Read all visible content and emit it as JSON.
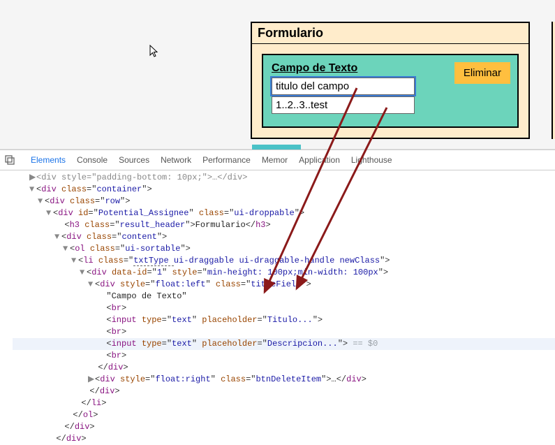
{
  "form": {
    "header": "Formulario",
    "field_label": "Campo de Texto",
    "delete_label": "Eliminar",
    "title_value": "titulo del campo",
    "title_placeholder": "Titulo...",
    "desc_value": "1..2..3..test",
    "desc_placeholder": "Descripcion..."
  },
  "devtools": {
    "tabs": [
      "Elements",
      "Console",
      "Sources",
      "Network",
      "Performance",
      "Memor",
      "Application",
      "Lighthouse"
    ],
    "partial_top": "<div style=\"padding-bottom: 10px;\">…</div>",
    "l_container_open": "<div class=\"container\">",
    "l_row_open": "<div class=\"row\">",
    "l_potential_open": "<div id=\"Potential_Assignee\" class=\"ui-droppable\">",
    "l_h3": "<h3 class=\"result_header\">Formulario</h3>",
    "l_content_open": "<div class=\"content\">",
    "l_ol_open": "<ol class=\"ui-sortable\">",
    "l_li_open_pre": "<li class=\"",
    "l_li_class_txtType": "txtType ",
    "l_li_open_post": "ui-draggable ui-draggable-handle newClass\">",
    "l_div_dataid": "<div data-id=\"1\" style=\"min-height: 100px;min-width: 100px\">",
    "l_div_titlefield": "<div style=\"float:left\" class=\"titleField\">",
    "l_text_campo": "\"Campo de Texto\"",
    "l_br": "<br>",
    "l_input1": "<input type=\"text\" placeholder=\"Titulo...\">",
    "l_input2": "<input type=\"text\" placeholder=\"Descripcion...\">",
    "l_eq0": " == $0",
    "l_divclose": "</div>",
    "l_btndelete": "<div style=\"float:right\" class=\"btnDeleteItem\">…</div>",
    "l_liclose": "</li>",
    "l_olclose": "</ol>"
  }
}
